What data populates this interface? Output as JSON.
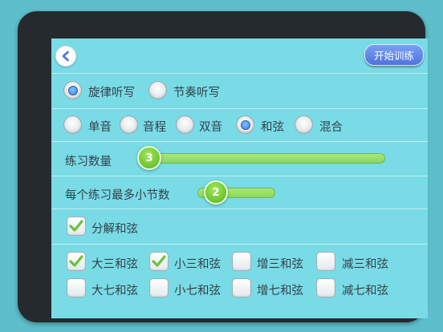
{
  "header": {
    "back_icon": "chevron-left-icon",
    "start_label": "开始训练"
  },
  "dictation_mode": {
    "options": [
      {
        "label": "旋律听写",
        "selected": true
      },
      {
        "label": "节奏听写",
        "selected": false
      }
    ]
  },
  "interval_type": {
    "options": [
      {
        "label": "单音",
        "selected": false
      },
      {
        "label": "音程",
        "selected": false
      },
      {
        "label": "双音",
        "selected": false
      },
      {
        "label": "和弦",
        "selected": true
      },
      {
        "label": "混合",
        "selected": false
      }
    ]
  },
  "exercise_count": {
    "label": "练习数量",
    "value": "3"
  },
  "max_bars": {
    "label": "每个练习最多小节数",
    "value": "2"
  },
  "arpeggio": {
    "label": "分解和弦",
    "checked": true
  },
  "chords": [
    {
      "label": "大三和弦",
      "checked": true
    },
    {
      "label": "小三和弦",
      "checked": true
    },
    {
      "label": "增三和弦",
      "checked": false
    },
    {
      "label": "减三和弦",
      "checked": false
    },
    {
      "label": "大七和弦",
      "checked": false
    },
    {
      "label": "小七和弦",
      "checked": false
    },
    {
      "label": "增七和弦",
      "checked": false
    },
    {
      "label": "减七和弦",
      "checked": false
    }
  ],
  "colors": {
    "screen_bg": "#79dbe6",
    "accent_blue": "#4d73dc",
    "slider_green": "#55b11d"
  }
}
